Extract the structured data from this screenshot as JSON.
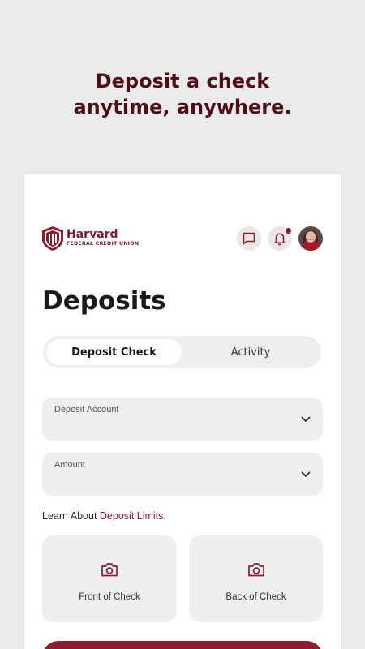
{
  "headline": {
    "line1": "Deposit a check",
    "line2": "anytime, anywhere."
  },
  "brand": {
    "name": "Harvard",
    "subtitle": "FEDERAL CREDIT UNION",
    "color": "#8b1d2e"
  },
  "header": {
    "icons": [
      "chat-icon",
      "bell-icon"
    ],
    "notification_dot": true
  },
  "page": {
    "title": "Deposits"
  },
  "tabs": [
    {
      "label": "Deposit Check",
      "active": true
    },
    {
      "label": "Activity",
      "active": false
    }
  ],
  "fields": [
    {
      "label": "Deposit Account",
      "value": "",
      "icon": "chevron-down-icon"
    },
    {
      "label": "Amount",
      "value": "",
      "icon": "chevron-down-icon"
    }
  ],
  "limits": {
    "prefix": "Learn About ",
    "link": "Deposit Limits",
    "suffix": "."
  },
  "photos": [
    {
      "label": "Front of Check",
      "icon": "camera-icon"
    },
    {
      "label": "Back of Check",
      "icon": "camera-icon"
    }
  ]
}
